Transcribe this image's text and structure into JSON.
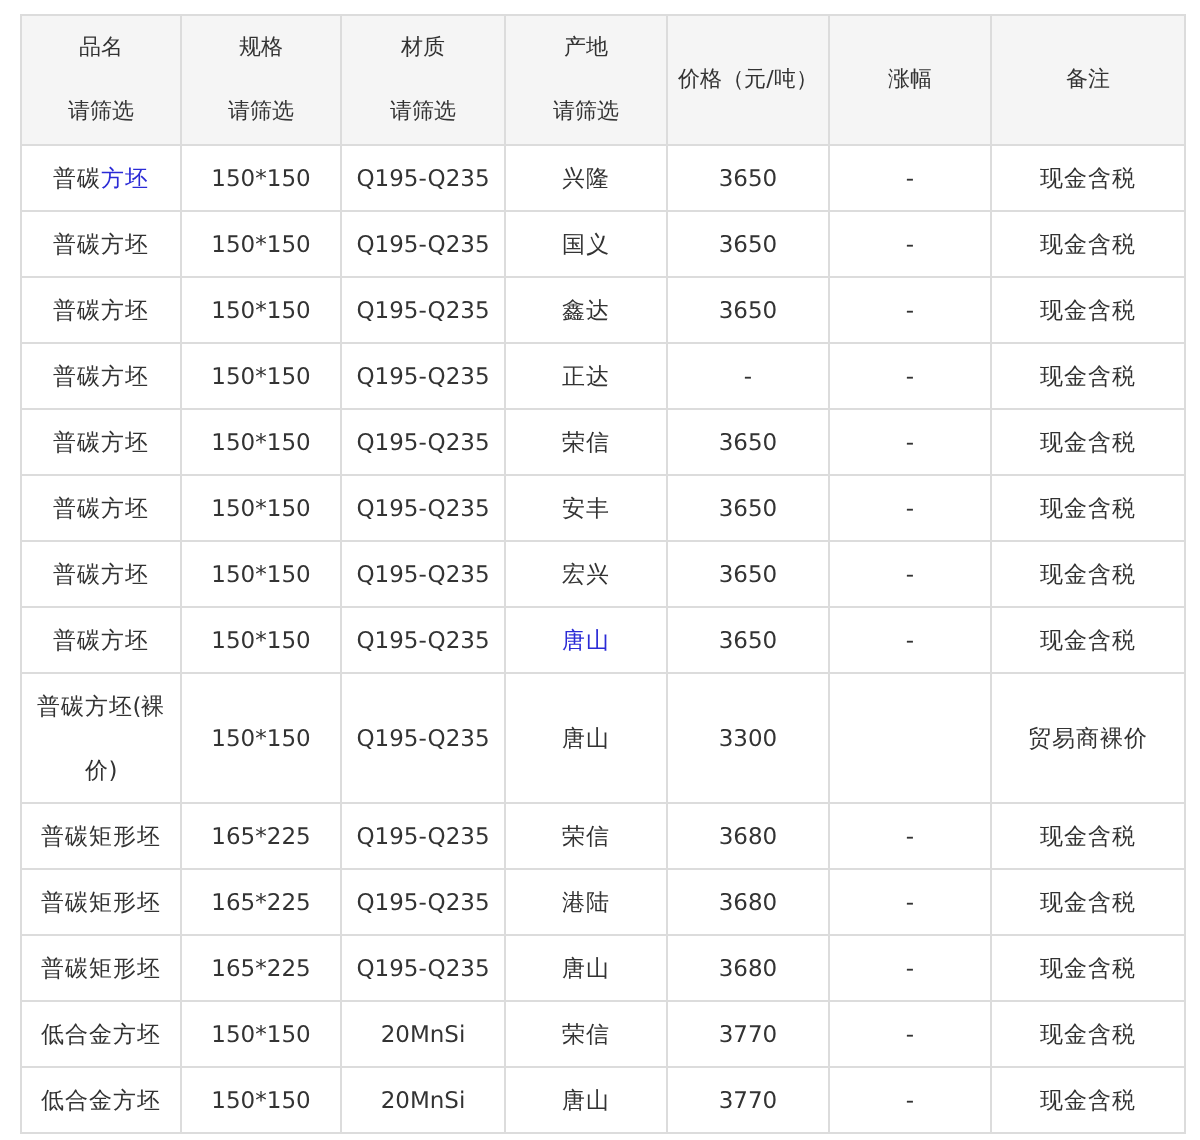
{
  "table": {
    "columns": [
      {
        "label": "品名",
        "filter": "请筛选"
      },
      {
        "label": "规格",
        "filter": "请筛选"
      },
      {
        "label": "材质",
        "filter": "请筛选"
      },
      {
        "label": "产地",
        "filter": "请筛选"
      },
      {
        "label": "价格（元/吨）"
      },
      {
        "label": "涨幅"
      },
      {
        "label": "备注"
      }
    ],
    "rows": [
      {
        "name": "普碳",
        "name_link": "方坯",
        "spec": "150*150",
        "material": "Q195-Q235",
        "origin": "兴隆",
        "origin_link": false,
        "price": "3650",
        "change": "-",
        "note": "现金含税"
      },
      {
        "name": "普碳方坯",
        "spec": "150*150",
        "material": "Q195-Q235",
        "origin": "国义",
        "origin_link": false,
        "price": "3650",
        "change": "-",
        "note": "现金含税"
      },
      {
        "name": "普碳方坯",
        "spec": "150*150",
        "material": "Q195-Q235",
        "origin": "鑫达",
        "origin_link": false,
        "price": "3650",
        "change": "-",
        "note": "现金含税"
      },
      {
        "name": "普碳方坯",
        "spec": "150*150",
        "material": "Q195-Q235",
        "origin": "正达",
        "origin_link": false,
        "price": "-",
        "change": "-",
        "note": "现金含税"
      },
      {
        "name": "普碳方坯",
        "spec": "150*150",
        "material": "Q195-Q235",
        "origin": "荣信",
        "origin_link": false,
        "price": "3650",
        "change": "-",
        "note": "现金含税"
      },
      {
        "name": "普碳方坯",
        "spec": "150*150",
        "material": "Q195-Q235",
        "origin": "安丰",
        "origin_link": false,
        "price": "3650",
        "change": "-",
        "note": "现金含税"
      },
      {
        "name": "普碳方坯",
        "spec": "150*150",
        "material": "Q195-Q235",
        "origin": "宏兴",
        "origin_link": false,
        "price": "3650",
        "change": "-",
        "note": "现金含税"
      },
      {
        "name": "普碳方坯",
        "spec": "150*150",
        "material": "Q195-Q235",
        "origin": "唐山",
        "origin_link": true,
        "price": "3650",
        "change": "-",
        "note": "现金含税"
      },
      {
        "name": "普碳方坯(裸价)",
        "spec": "150*150",
        "material": "Q195-Q235",
        "origin": "唐山",
        "origin_link": false,
        "price": "3300",
        "note": "贸易商裸价"
      },
      {
        "name": "普碳矩形坯",
        "spec": "165*225",
        "material": "Q195-Q235",
        "origin": "荣信",
        "origin_link": false,
        "price": "3680",
        "change": "-",
        "note": "现金含税"
      },
      {
        "name": "普碳矩形坯",
        "spec": "165*225",
        "material": "Q195-Q235",
        "origin": "港陆",
        "origin_link": false,
        "price": "3680",
        "change": "-",
        "note": "现金含税"
      },
      {
        "name": "普碳矩形坯",
        "spec": "165*225",
        "material": "Q195-Q235",
        "origin": "唐山",
        "origin_link": false,
        "price": "3680",
        "change": "-",
        "note": "现金含税"
      },
      {
        "name": "低合金方坯",
        "spec": "150*150",
        "material": "20MnSi",
        "origin": "荣信",
        "origin_link": false,
        "price": "3770",
        "change": "-",
        "note": "现金含税"
      },
      {
        "name": "低合金方坯",
        "spec": "150*150",
        "material": "20MnSi",
        "origin": "唐山",
        "origin_link": false,
        "price": "3770",
        "change": "-",
        "note": "现金含税"
      }
    ]
  }
}
